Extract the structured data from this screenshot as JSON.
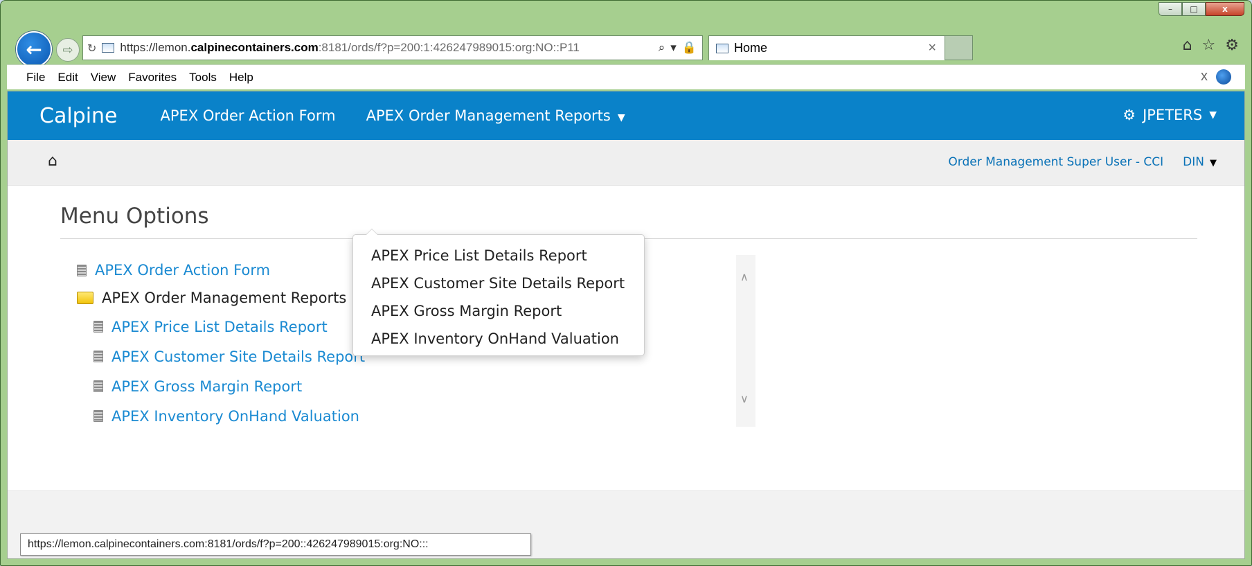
{
  "browser": {
    "address_url_prefix": "https://lemon.",
    "address_url_domain": "calpinecontainers.com",
    "address_url_suffix": ":8181/ords/f?p=200:1:426247989015:org:NO::P11",
    "tab_title": "Home",
    "status_url": "https://lemon.calpinecontainers.com:8181/ords/f?p=200::426247989015:org:NO:::"
  },
  "menubar": {
    "file": "File",
    "edit": "Edit",
    "view": "View",
    "favorites": "Favorites",
    "tools": "Tools",
    "help": "Help"
  },
  "app": {
    "brand": "Calpine",
    "nav_action_form": "APEX Order Action Form",
    "nav_reports": "APEX Order Management Reports",
    "user": "JPETERS",
    "role": "Order Management Super User - CCI",
    "lang": "DIN"
  },
  "dropdown": {
    "items": [
      "APEX Price List Details Report",
      "APEX Customer Site Details Report",
      "APEX Gross Margin Report",
      "APEX Inventory OnHand Valuation"
    ]
  },
  "menu": {
    "title": "Menu Options",
    "items": [
      "APEX Order Action Form",
      "APEX Order Management Reports",
      "APEX Price List Details Report",
      "APEX Customer Site Details Report",
      "APEX Gross Margin Report",
      "APEX Inventory OnHand Valuation"
    ]
  },
  "icons": {
    "back": "back-arrow-icon",
    "forward": "forward-arrow-icon",
    "home": "home-icon",
    "star": "favorites-star-icon",
    "gear": "gear-icon",
    "folder": "folder-icon",
    "document": "document-icon"
  },
  "colors": {
    "app_bar": "#0a82c9",
    "link": "#1a8ad2",
    "window_frame": "#a6cf8f"
  }
}
